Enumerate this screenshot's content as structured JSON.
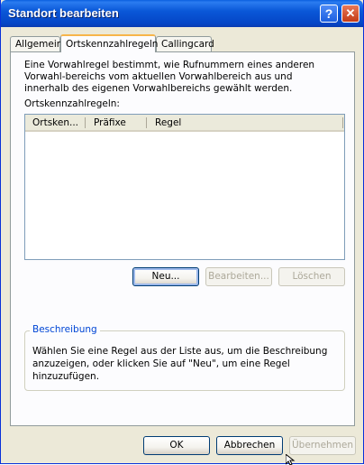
{
  "window": {
    "title": "Standort bearbeiten"
  },
  "titlebar": {
    "help_glyph": "?",
    "close_glyph": "✕"
  },
  "tabs": [
    {
      "label": "Allgemein"
    },
    {
      "label": "Ortskennzahlregeln"
    },
    {
      "label": "Callingcard"
    }
  ],
  "panel": {
    "intro_text": "Eine Vorwahlregel bestimmt, wie Rufnummern eines anderen Vorwahl-bereichs vom aktuellen Vorwahlbereich aus und innerhalb des eigenen Vorwahlbereichs gewählt werden.",
    "list_label": "Ortskennzahlregeln:",
    "columns": [
      "Ortsken...",
      "Präfixe",
      "Regel"
    ],
    "rows": [],
    "buttons": {
      "new": "Neu...",
      "edit": "Bearbeiten...",
      "delete": "Löschen"
    },
    "description": {
      "title": "Beschreibung",
      "text": "Wählen Sie eine Regel aus der Liste aus, um die Beschreibung anzuzeigen, oder klicken Sie auf \"Neu\", um eine Regel hinzuzufügen."
    }
  },
  "footer": {
    "ok": "OK",
    "cancel": "Abbrechen",
    "apply": "Übernehmen"
  }
}
